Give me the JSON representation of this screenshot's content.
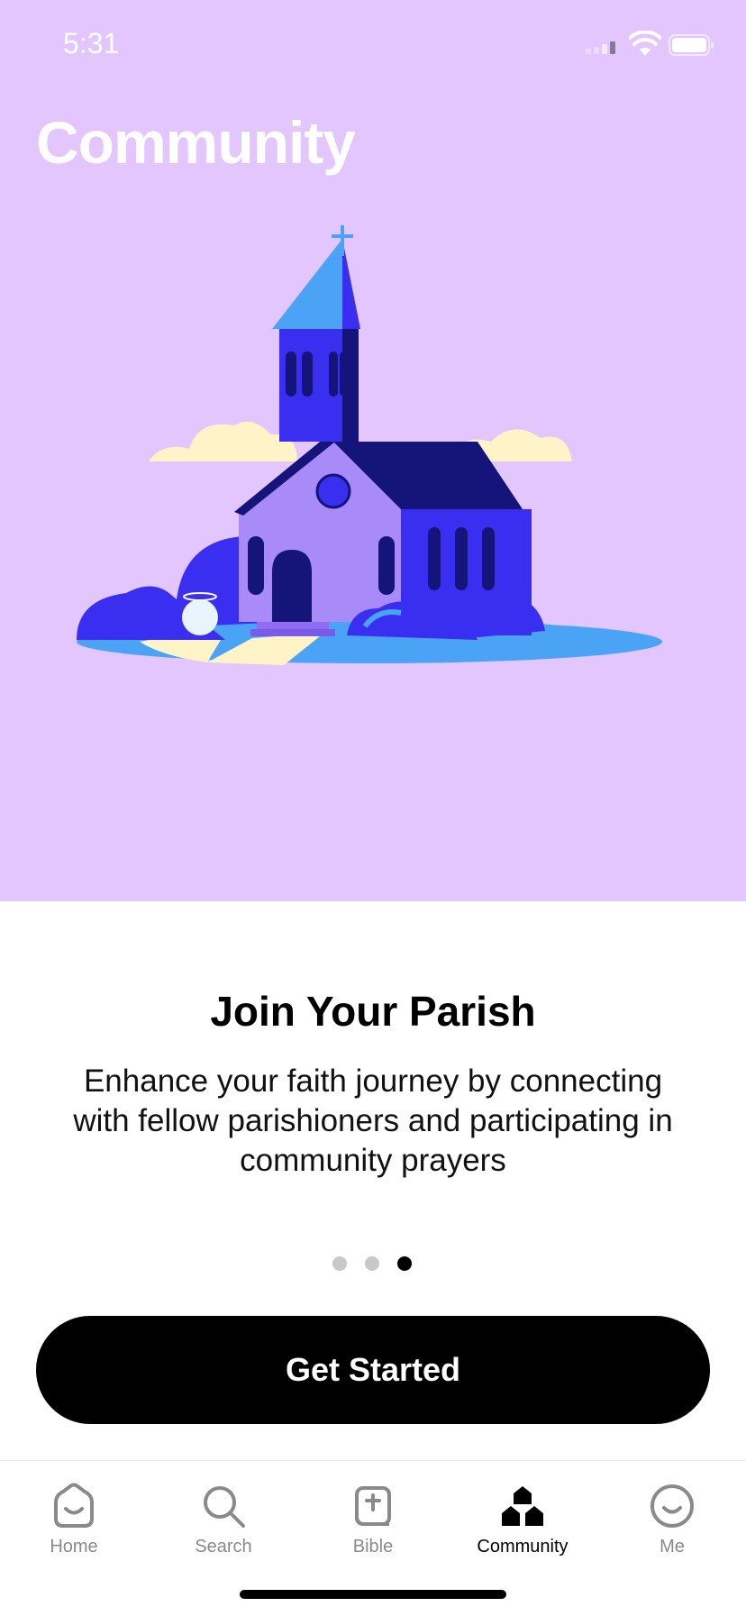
{
  "status_bar": {
    "time": "5:31"
  },
  "header": {
    "title": "Community"
  },
  "onboarding": {
    "heading": "Join Your Parish",
    "body": "Enhance your faith journey by connecting with fellow parishioners and participating in community prayers",
    "page_count": 3,
    "current_page": 3
  },
  "cta": {
    "label": "Get Started"
  },
  "tabs": [
    {
      "label": "Home",
      "icon": "home-icon"
    },
    {
      "label": "Search",
      "icon": "search-icon"
    },
    {
      "label": "Bible",
      "icon": "bible-icon"
    },
    {
      "label": "Community",
      "icon": "community-icon"
    },
    {
      "label": "Me",
      "icon": "me-icon"
    }
  ],
  "active_tab": "Community",
  "colors": {
    "hero_background": "#e2c6fd",
    "accent_blue": "#3a2ff0",
    "sky_blue": "#4aa3f5",
    "navy": "#14147a"
  }
}
